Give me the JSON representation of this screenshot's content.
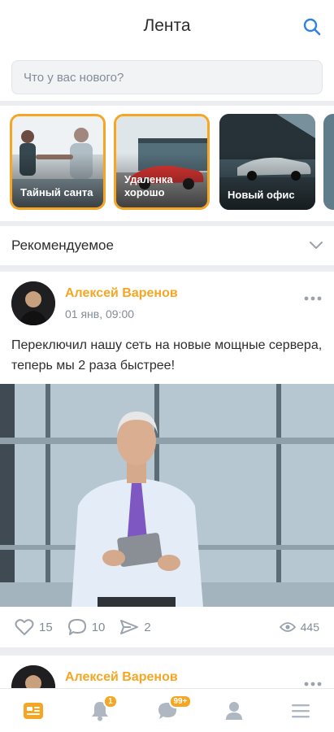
{
  "header": {
    "title": "Лента",
    "search_icon": "search-icon"
  },
  "composer": {
    "placeholder": "Что у вас нового?"
  },
  "stories": [
    {
      "label": "Тайный санта",
      "unread": true
    },
    {
      "label": "Удаленка хорошо",
      "unread": true
    },
    {
      "label": "Новый офис",
      "unread": false
    }
  ],
  "filter": {
    "label": "Рекомендуемое",
    "icon": "chevron-down-icon"
  },
  "post": {
    "author": "Алексей Варенов",
    "date": "01 янв, 09:00",
    "text": "Переключил нашу сеть на новые мощные сервера, теперь мы 2 раза быстрее!",
    "likes": "15",
    "comments": "10",
    "shares": "2",
    "views": "445"
  },
  "post2": {
    "author": "Алексей Варенов"
  },
  "tabbar": {
    "items": [
      {
        "icon": "feed-icon",
        "active": true
      },
      {
        "icon": "bell-icon",
        "badge": "1"
      },
      {
        "icon": "chat-icon",
        "badge": "99+"
      },
      {
        "icon": "profile-icon"
      },
      {
        "icon": "menu-icon"
      }
    ]
  },
  "colors": {
    "accent": "#f5a623",
    "link": "#2d81e0",
    "muted": "#818c99"
  }
}
